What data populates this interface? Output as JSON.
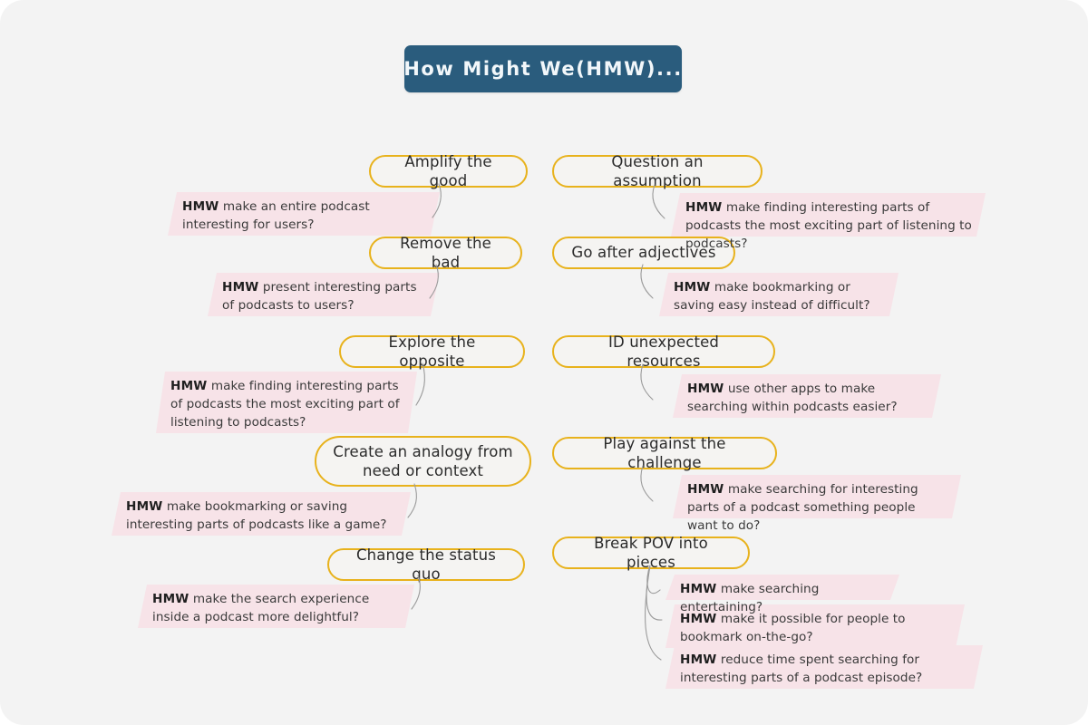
{
  "header": {
    "title": "How Might We(HMW)...",
    "color": "#2a5c7d",
    "text_color": "#f2f7fa"
  },
  "theme": {
    "canvas_bg": "#f3f3f3",
    "pill_border": "#e8b21c",
    "pill_bg": "#f5f4f2",
    "note_bg": "#f7e3e8",
    "note_text": "#3a3a3a",
    "connector": "#9a9a9a"
  },
  "labels": {
    "hmw_prefix": "HMW"
  },
  "branches": [
    {
      "id": "amplify-the-good",
      "column": "left",
      "label": "Amplify the good",
      "notes": [
        {
          "prefix": "HMW",
          "text": "make an entire podcast interesting for users?"
        }
      ]
    },
    {
      "id": "remove-the-bad",
      "column": "left",
      "label": "Remove the bad",
      "notes": [
        {
          "prefix": "HMW",
          "text": "present interesting parts of podcasts to users?"
        }
      ]
    },
    {
      "id": "explore-the-opposite",
      "column": "left",
      "label": "Explore the opposite",
      "notes": [
        {
          "prefix": "HMW",
          "text": "make finding interesting parts of podcasts the most exciting part of listening to podcasts?"
        }
      ]
    },
    {
      "id": "create-an-analogy",
      "column": "left",
      "label": "Create an analogy from need or context",
      "notes": [
        {
          "prefix": "HMW",
          "text": "make bookmarking or saving interesting parts of podcasts like a game?"
        }
      ]
    },
    {
      "id": "change-the-status-quo",
      "column": "left",
      "label": "Change the status quo",
      "notes": [
        {
          "prefix": "HMW",
          "text": "make the search experience inside a podcast more delightful?"
        }
      ]
    },
    {
      "id": "question-an-assumption",
      "column": "right",
      "label": "Question an assumption",
      "notes": [
        {
          "prefix": "HMW",
          "text": "make finding interesting parts of podcasts the most exciting part of listening to podcasts?"
        }
      ]
    },
    {
      "id": "go-after-adjectives",
      "column": "right",
      "label": "Go after adjectives",
      "notes": [
        {
          "prefix": "HMW",
          "text": "make bookmarking or saving easy instead of difficult?"
        }
      ]
    },
    {
      "id": "id-unexpected-resources",
      "column": "right",
      "label": "ID unexpected resources",
      "notes": [
        {
          "prefix": "HMW",
          "text": "use other apps to make searching within podcasts easier?"
        }
      ]
    },
    {
      "id": "play-against-the-challenge",
      "column": "right",
      "label": "Play against the challenge",
      "notes": [
        {
          "prefix": "HMW",
          "text": "make searching for interesting parts of a podcast something people want to do?"
        }
      ]
    },
    {
      "id": "break-pov-into-pieces",
      "column": "right",
      "label": "Break POV into pieces",
      "notes": [
        {
          "prefix": "HMW",
          "text": "make searching entertaining?"
        },
        {
          "prefix": "HMW",
          "text": "make it possible for people to bookmark on-the-go?"
        },
        {
          "prefix": "HMW",
          "text": "reduce time spent searching for interesting parts of a podcast episode?"
        }
      ]
    }
  ]
}
